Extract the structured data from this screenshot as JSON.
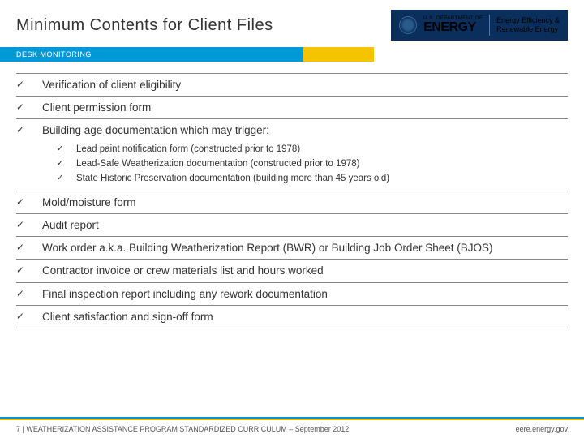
{
  "header": {
    "title": "Minimum Contents for Client Files",
    "logo": {
      "dept": "U.S. DEPARTMENT OF",
      "name": "ENERGY",
      "sub1": "Energy Efficiency &",
      "sub2": "Renewable Energy"
    }
  },
  "band": {
    "label": "DESK MONITORING"
  },
  "items": [
    {
      "text": "Verification of client eligibility"
    },
    {
      "text": "Client permission form"
    },
    {
      "text": "Building age documentation which may trigger:",
      "sub": [
        "Lead paint notification form  (constructed prior to 1978)",
        "Lead-Safe Weatherization documentation (constructed prior to 1978)",
        "State Historic Preservation documentation (building more than 45 years old)"
      ]
    },
    {
      "text": "Mold/moisture form"
    },
    {
      "text": "Audit report"
    },
    {
      "text": "Work order a.k.a. Building Weatherization Report (BWR) or Building Job Order Sheet (BJOS)"
    },
    {
      "text": "Contractor invoice or crew materials list and hours worked"
    },
    {
      "text": "Final inspection report including any rework documentation"
    },
    {
      "text": "Client satisfaction and sign-off form"
    }
  ],
  "footer": {
    "left": "7 | WEATHERIZATION ASSISTANCE PROGRAM STANDARDIZED CURRICULUM – September 2012",
    "right": "eere.energy.gov"
  }
}
